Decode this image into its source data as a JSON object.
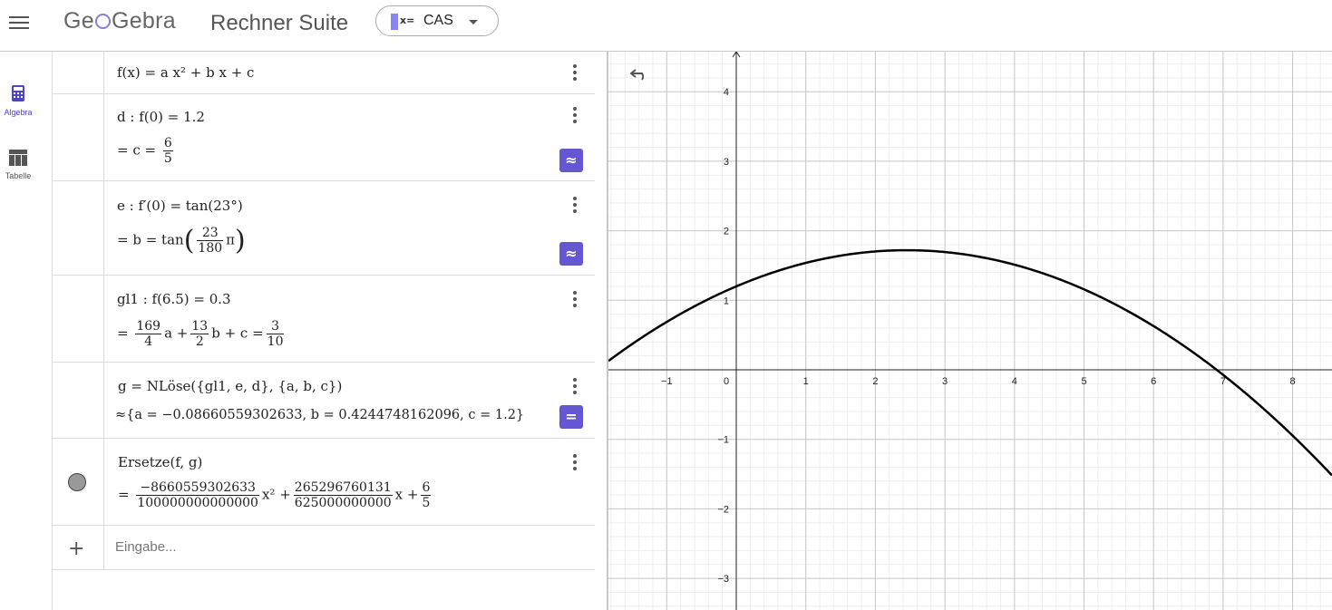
{
  "header": {
    "logo_text_1": "Ge",
    "logo_text_2": "Gebra",
    "title": "Rechner Suite",
    "app_icon_text": "x=",
    "app_selected": "CAS"
  },
  "sidenav": {
    "algebra_label": "Algebra",
    "table_label": "Tabelle"
  },
  "algebra": {
    "row1": {
      "input": "f(x) = a x² + b x + c"
    },
    "row2": {
      "input": "d : f(0) = 1.2",
      "out_prefix": "= c =",
      "out_num": "6",
      "out_den": "5",
      "button": "≈"
    },
    "row3": {
      "input": "e : f′(0) = tan(23°)",
      "out_prefix": "= b = tan",
      "out_num": "23",
      "out_den": "180",
      "out_suffix": "π",
      "button": "≈"
    },
    "row4": {
      "input": "gl1 : f(6.5) = 0.3",
      "eq": "=",
      "n1": "169",
      "d1": "4",
      "a": "a +",
      "n2": "13",
      "d2": "2",
      "rest": "b + c =",
      "n3": "3",
      "d3": "10"
    },
    "row5": {
      "input": "g = NLöse({gl1, e, d}, {a, b, c})",
      "output": "≈{a = −0.08660559302633, b = 0.4244748162096, c = 1.2}",
      "button": "="
    },
    "row6": {
      "input": "Ersetze(f, g)",
      "eq": "=",
      "n1": "−8660559302633",
      "d1": "100000000000000",
      "x2": "x² +",
      "n2": "265296760131",
      "d2": "625000000000",
      "xp": "x +",
      "n3": "6",
      "d3": "5"
    },
    "input_row": {
      "placeholder": "Eingabe..."
    }
  },
  "graphics": {
    "x_ticks": [
      "−1",
      "0",
      "1",
      "2",
      "3",
      "4",
      "5",
      "6",
      "7",
      "8"
    ],
    "y_ticks": [
      "4",
      "3",
      "2",
      "1",
      "−1",
      "−2",
      "−3"
    ],
    "curve_color": "#000000"
  },
  "colors": {
    "accent": "#6557d2",
    "logo": "#8b7fd3"
  }
}
